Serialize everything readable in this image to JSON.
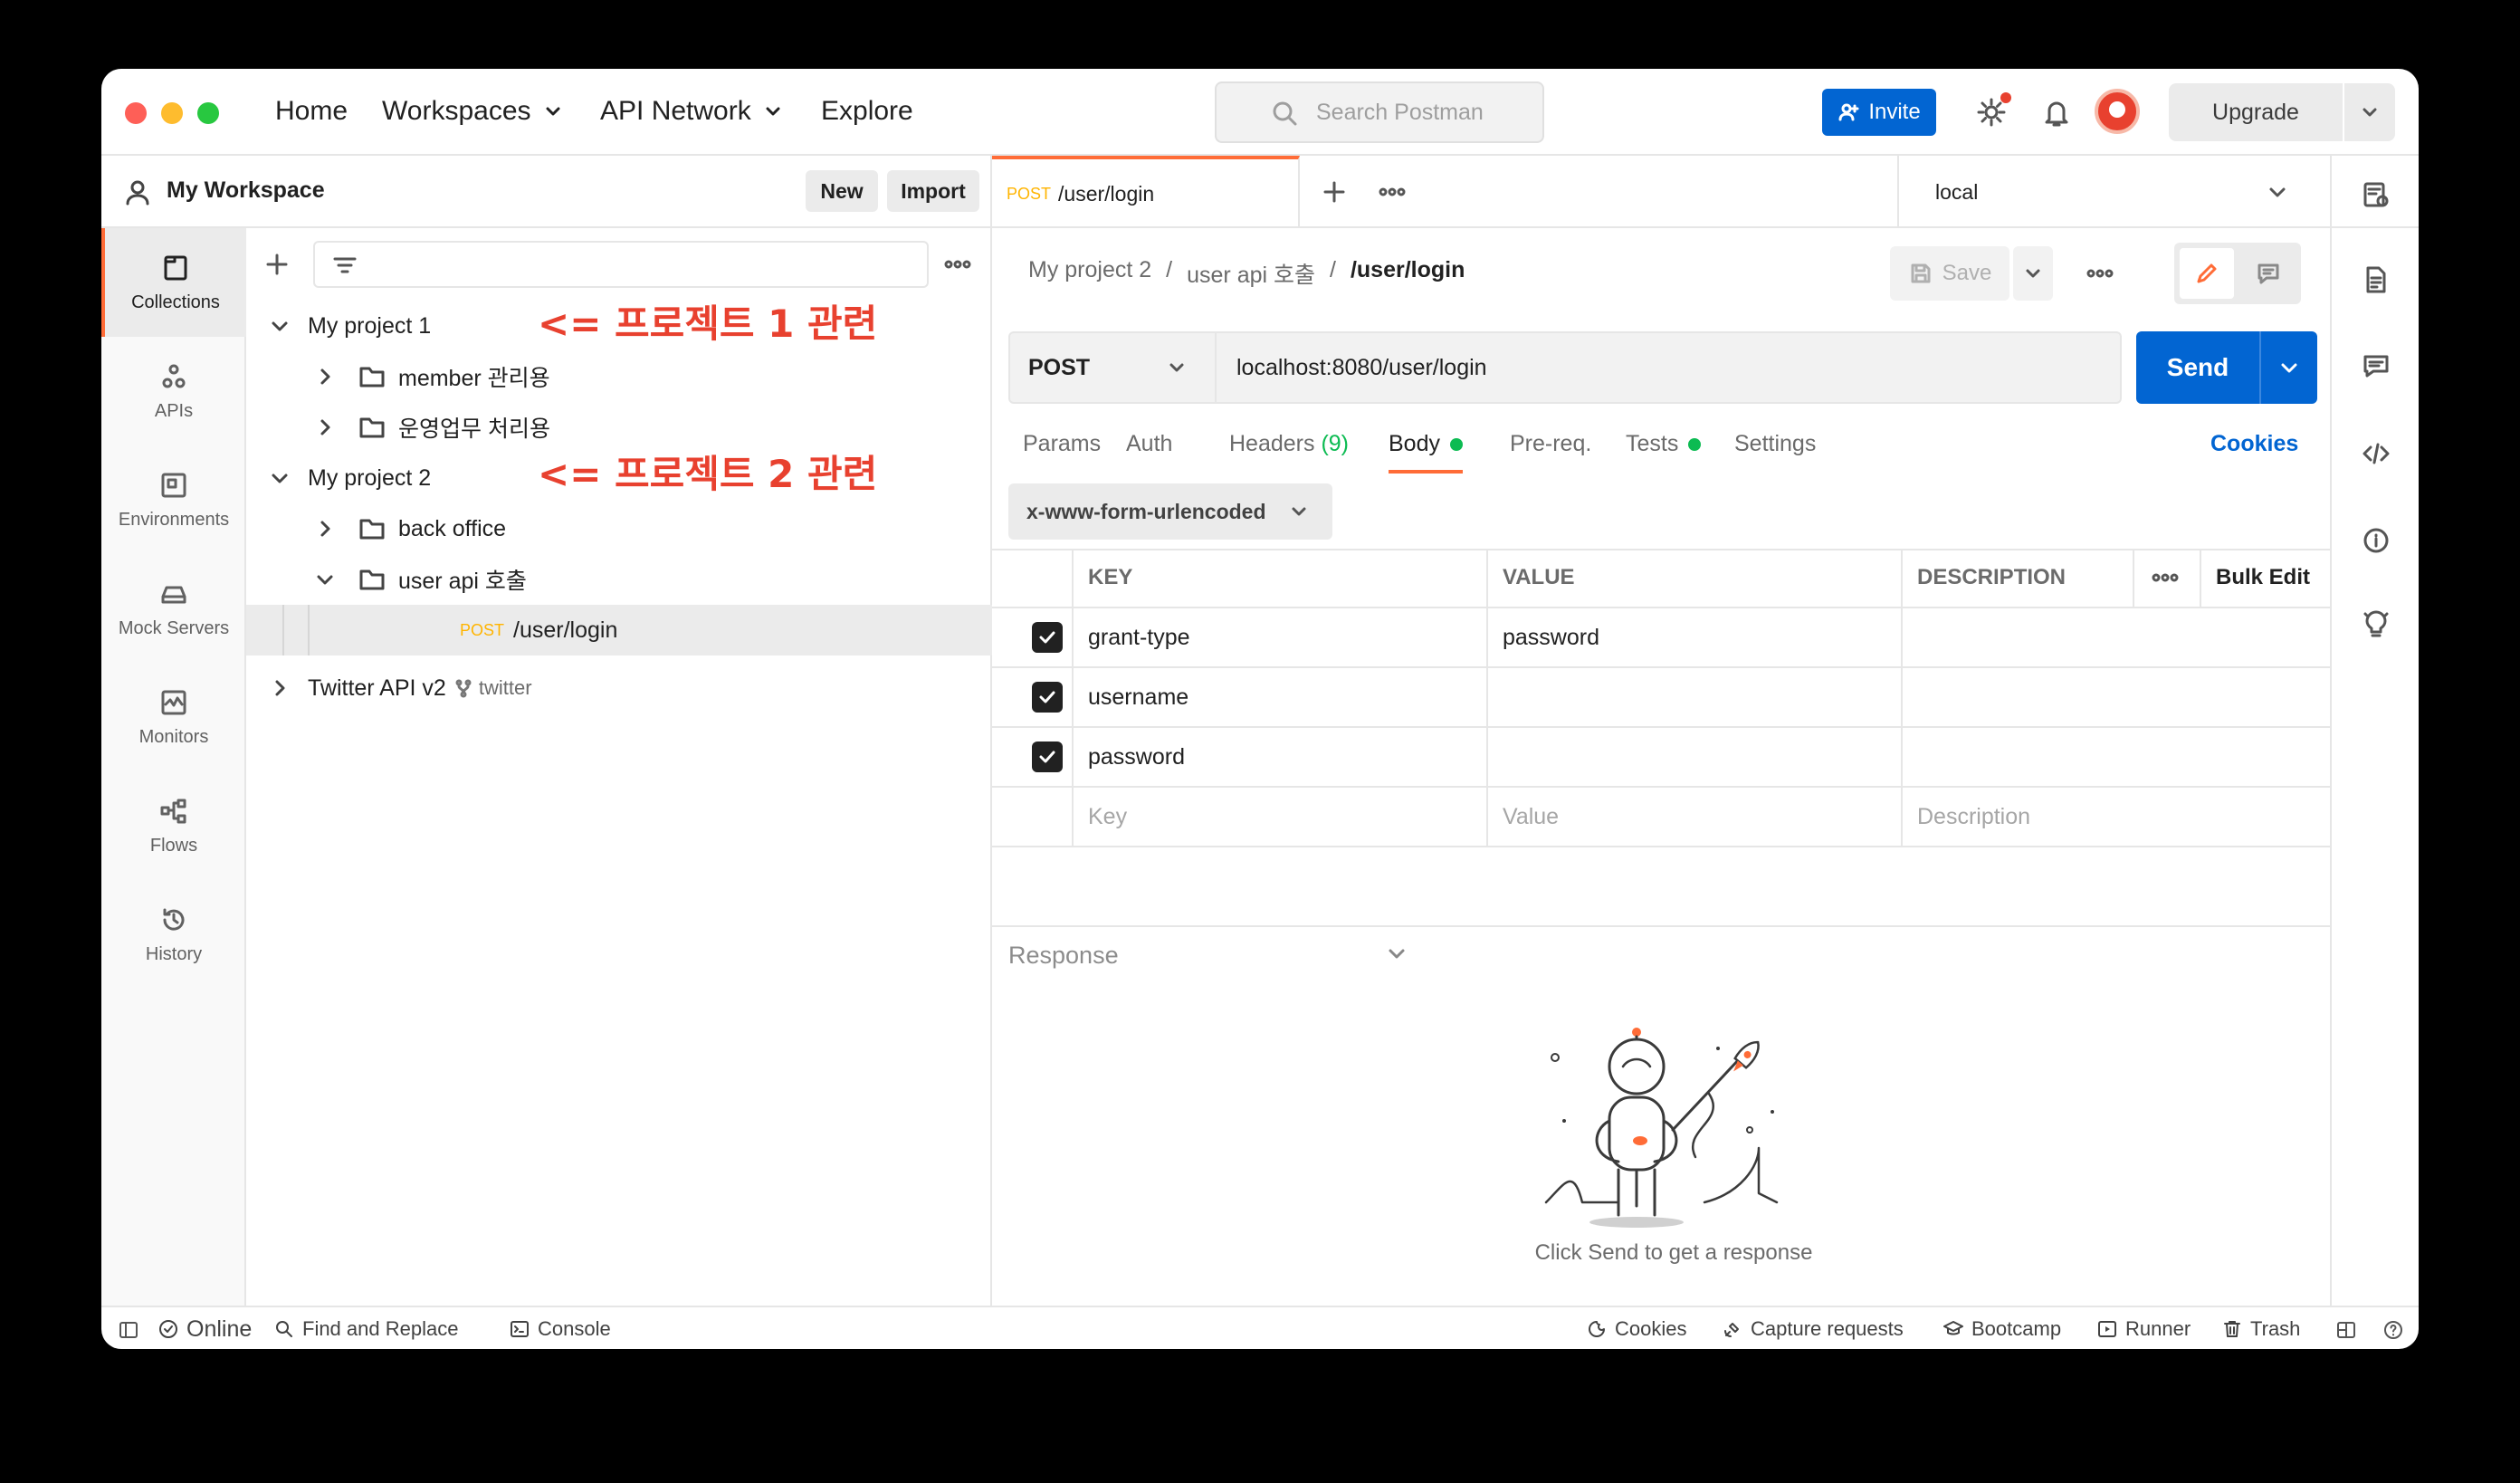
{
  "header": {
    "nav": [
      "Home",
      "Workspaces",
      "API Network",
      "Explore"
    ],
    "search_placeholder": "Search Postman",
    "invite_label": "Invite",
    "upgrade_label": "Upgrade"
  },
  "workspace": {
    "name": "My Workspace",
    "new_label": "New",
    "import_label": "Import"
  },
  "rail": [
    "Collections",
    "APIs",
    "Environments",
    "Mock Servers",
    "Monitors",
    "Flows",
    "History"
  ],
  "tree": {
    "project1": "My project 1",
    "p1_folders": [
      "member 관리용",
      "운영업무 처리용"
    ],
    "project2": "My project 2",
    "p2_folders": [
      "back office",
      "user api 호출"
    ],
    "request_method": "POST",
    "request_name": "/user/login",
    "twitter_name": "Twitter API v2",
    "twitter_fork": "twitter",
    "annotation1": "<= 프로젝트 1 관련",
    "annotation2": "<= 프로젝트 2 관련"
  },
  "tab": {
    "method": "POST",
    "name": "/user/login",
    "environment": "local"
  },
  "breadcrumb": [
    "My project 2",
    "user api 호출",
    "/user/login"
  ],
  "save_label": "Save",
  "request": {
    "method": "POST",
    "url": "localhost:8080/user/login",
    "send_label": "Send"
  },
  "request_tabs": [
    "Params",
    "Auth",
    "Headers",
    "Body",
    "Pre-req.",
    "Tests",
    "Settings"
  ],
  "headers_count": "(9)",
  "cookies_label": "Cookies",
  "body_type": "x-www-form-urlencoded",
  "table": {
    "headers": [
      "KEY",
      "VALUE",
      "DESCRIPTION"
    ],
    "bulk_edit": "Bulk Edit",
    "rows": [
      {
        "key": "grant-type",
        "value": "password",
        "description": ""
      },
      {
        "key": "username",
        "value": "",
        "description": ""
      },
      {
        "key": "password",
        "value": "",
        "description": ""
      }
    ],
    "placeholders": [
      "Key",
      "Value",
      "Description"
    ]
  },
  "response": {
    "title": "Response",
    "empty_message": "Click Send to get a response"
  },
  "status_bar": {
    "left": [
      "Online",
      "Find and Replace",
      "Console"
    ],
    "right": [
      "Cookies",
      "Capture requests",
      "Bootcamp",
      "Runner",
      "Trash"
    ]
  },
  "colors": {
    "accent": "#ff6c37",
    "primary": "#0265d2",
    "annotation": "#e8412f",
    "method_post": "#ffb400",
    "indicator": "#0cbb52"
  }
}
